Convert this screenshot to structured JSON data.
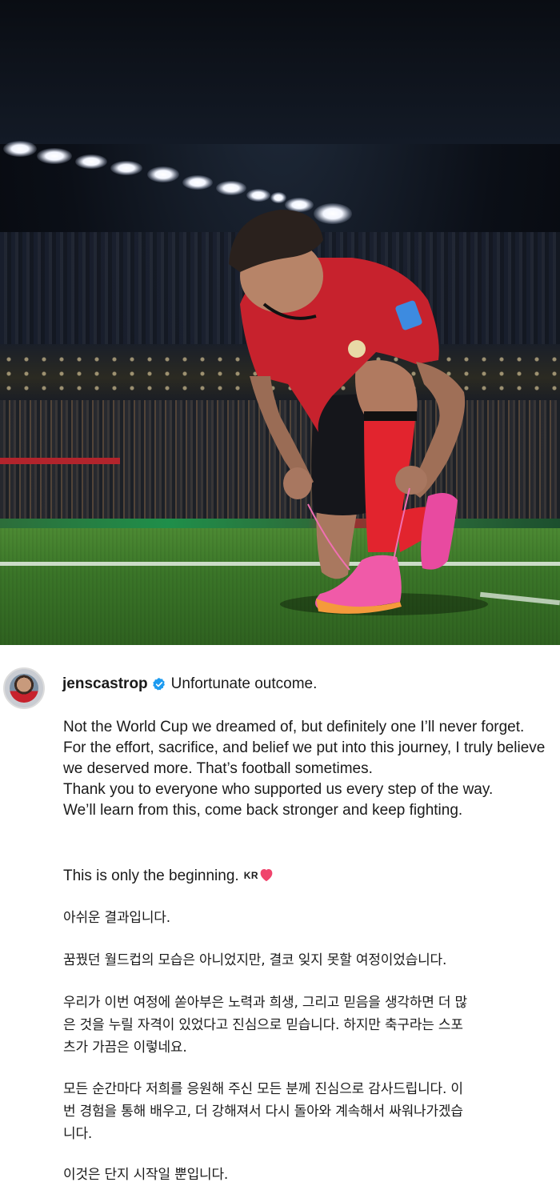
{
  "post": {
    "username": "jenscastrop",
    "caption_first_line": "Unfortunate outcome.",
    "en_paragraph_1": "Not the World Cup we dreamed of, but definitely one I’ll never forget.\nFor the effort, sacrifice, and belief we put into this journey, I truly believe we deserved more. That’s football sometimes.\nThank you to everyone who supported us every step of the way.\nWe’ll learn from this, come back stronger and keep fighting.",
    "en_closing": "This is only the beginning.",
    "flag_text": "KR",
    "ko_line_1": "아쉬운 결과입니다.",
    "ko_line_2": "꿈꿨던 월드컵의 모습은 아니었지만, 결코 잊지 못할 여정이었습니다.",
    "ko_line_3": "우리가 이번 여정에 쏟아부은 노력과 희생, 그리고 믿음을 생각하면 더 많\n은 것을 누릴 자격이 있었다고 진심으로 믿습니다. 하지만 축구라는 스포\n츠가 가끔은 이렇네요.",
    "ko_line_4": "모든 순간마다 저희를 응원해 주신 모든 분께 진심으로 감사드립니다. 이\n번 경험을 통해 배우고, 더 강해져서 다시 돌아와 계속해서 싸워나가겠습\n니다.",
    "ko_line_5": "이것은 단지 시작일 뿐입니다."
  },
  "icons": {
    "verified": "verified-badge-icon",
    "heart": "pink-heart-icon",
    "verified_color": "#1d9bf0",
    "heart_color": "#f0446c"
  },
  "colors": {
    "jersey_red": "#c7222d",
    "boot_pink": "#f05aa8",
    "pitch_green": "#3a7528"
  }
}
